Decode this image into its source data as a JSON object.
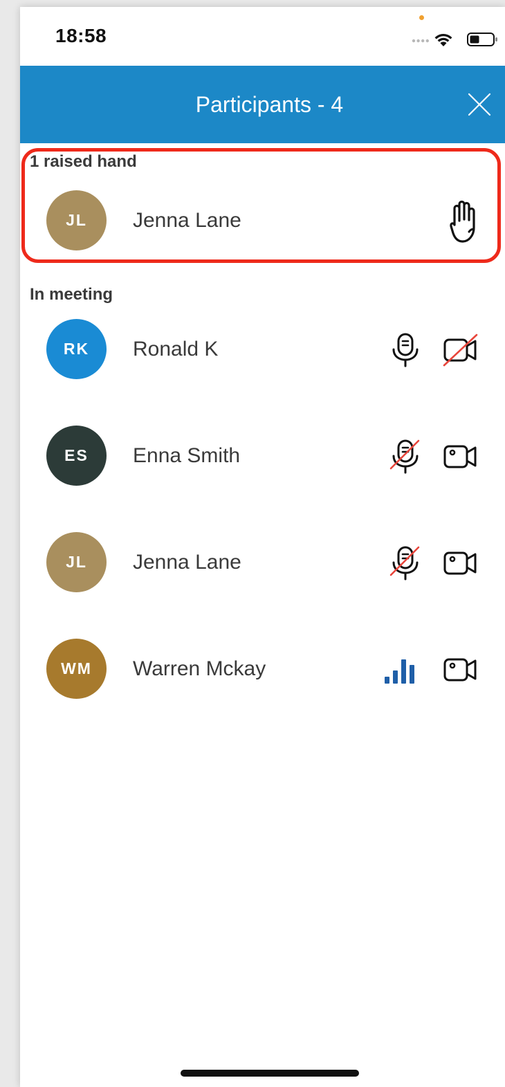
{
  "status_bar": {
    "time": "18:58"
  },
  "header": {
    "title": "Participants - 4",
    "background": "#1c88c7"
  },
  "raised_section": {
    "label": "1 raised hand",
    "highlight_color": "#ee2a1b",
    "participants": [
      {
        "initials": "JL",
        "name": "Jenna Lane",
        "avatar_color": "#a98f5e",
        "icon": "raised-hand-icon"
      }
    ]
  },
  "meeting_section": {
    "label": "In meeting",
    "participants": [
      {
        "initials": "RK",
        "name": "Ronald K",
        "avatar_color": "#1a8bd4",
        "mic": "microphone-icon",
        "video": "video-off-icon"
      },
      {
        "initials": "ES",
        "name": "Enna Smith",
        "avatar_color": "#2c3b38",
        "mic": "microphone-muted-icon",
        "video": "video-icon"
      },
      {
        "initials": "JL",
        "name": "Jenna Lane",
        "avatar_color": "#a98f5e",
        "mic": "microphone-muted-icon",
        "video": "video-icon"
      },
      {
        "initials": "WM",
        "name": "Warren Mckay",
        "avatar_color": "#a77a2d",
        "mic": "audio-level-icon",
        "video": "video-icon"
      }
    ]
  }
}
